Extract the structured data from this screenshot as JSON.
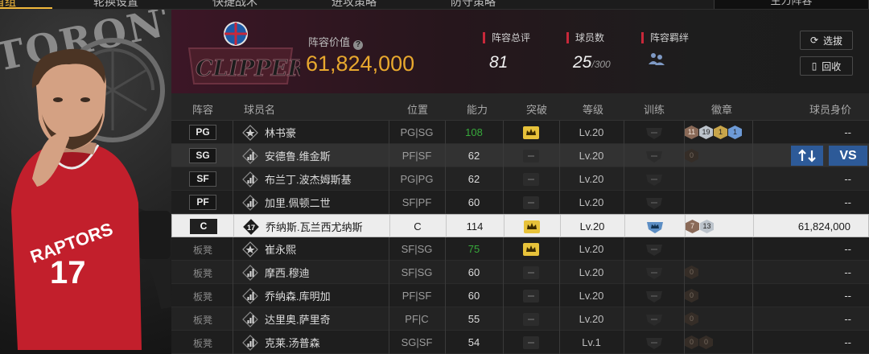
{
  "nav": {
    "tabs": [
      "首组",
      "轮换设置",
      "快捷战术",
      "进攻策略",
      "防守策略"
    ],
    "dropdown": "主力阵容"
  },
  "team": {
    "logo_text": "CLIPPERS",
    "value_label": "阵容价值",
    "value": "61,824,000",
    "overall_label": "阵容总评",
    "overall": "81",
    "players_label": "球员数",
    "players": "25",
    "players_max": "/300",
    "bonds_label": "阵容羁绊",
    "background_text": "TORONTO",
    "player_jersey_team": "RAPTORS",
    "player_jersey_number": "17"
  },
  "buttons": {
    "select": "选拔",
    "recycle": "回收",
    "vs": "VS"
  },
  "table": {
    "headers": [
      "阵容",
      "球员名",
      "位置",
      "能力",
      "突破",
      "等级",
      "训练",
      "徽章",
      "球员身价"
    ],
    "rows": [
      {
        "slot": "PG",
        "bench": false,
        "icon": "star",
        "name": "林书豪",
        "pos": "PG|SG",
        "ability": "108",
        "ability_color": "#37a93b",
        "breakthrough": true,
        "level": "Lv.20",
        "training": false,
        "badges": [
          {
            "v": "11",
            "c": "bronze"
          },
          {
            "v": "19",
            "c": "silver"
          },
          {
            "v": "1",
            "c": "gold"
          },
          {
            "v": "1",
            "c": "blue"
          }
        ],
        "value": "--"
      },
      {
        "slot": "SG",
        "bench": false,
        "icon": "bars",
        "name": "安德鲁.维金斯",
        "pos": "PF|SF",
        "ability": "62",
        "ability_color": "",
        "breakthrough": false,
        "level": "Lv.20",
        "training": false,
        "badges": [
          {
            "v": "0",
            "c": "empty"
          }
        ],
        "value": "",
        "has_actions": true
      },
      {
        "slot": "SF",
        "bench": false,
        "icon": "bars",
        "name": "布兰丁.波杰姆斯基",
        "pos": "PG|PG",
        "ability": "62",
        "ability_color": "",
        "breakthrough": false,
        "level": "Lv.20",
        "training": false,
        "badges": [],
        "value": "--"
      },
      {
        "slot": "PF",
        "bench": false,
        "icon": "bars",
        "name": "加里.佩顿二世",
        "pos": "SF|PF",
        "ability": "60",
        "ability_color": "",
        "breakthrough": false,
        "level": "Lv.20",
        "training": false,
        "badges": [],
        "value": "--"
      },
      {
        "slot": "C",
        "bench": false,
        "icon": "17",
        "name": "乔纳斯.瓦兰西尤纳斯",
        "pos": "C",
        "ability": "114",
        "ability_color": "",
        "breakthrough": true,
        "level": "Lv.20",
        "training": true,
        "badges": [
          {
            "v": "7",
            "c": "bronze"
          },
          {
            "v": "13",
            "c": "silver"
          }
        ],
        "value": "61,824,000",
        "selected": true
      },
      {
        "slot": "板凳",
        "bench": true,
        "icon": "star",
        "name": "崔永熙",
        "pos": "SF|SG",
        "ability": "75",
        "ability_color": "#37a93b",
        "breakthrough": true,
        "level": "Lv.20",
        "training": false,
        "badges": [],
        "value": "--"
      },
      {
        "slot": "板凳",
        "bench": true,
        "icon": "bars",
        "name": "摩西.穆迪",
        "pos": "SF|SG",
        "ability": "60",
        "ability_color": "",
        "breakthrough": false,
        "level": "Lv.20",
        "training": false,
        "badges": [
          {
            "v": "0",
            "c": "empty"
          }
        ],
        "value": "--"
      },
      {
        "slot": "板凳",
        "bench": true,
        "icon": "bars",
        "name": "乔纳森.库明加",
        "pos": "PF|SF",
        "ability": "60",
        "ability_color": "",
        "breakthrough": false,
        "level": "Lv.20",
        "training": false,
        "badges": [
          {
            "v": "0",
            "c": "empty"
          }
        ],
        "value": "--"
      },
      {
        "slot": "板凳",
        "bench": true,
        "icon": "bars",
        "name": "达里奥.萨里奇",
        "pos": "PF|C",
        "ability": "55",
        "ability_color": "",
        "breakthrough": false,
        "level": "Lv.20",
        "training": false,
        "badges": [
          {
            "v": "0",
            "c": "empty"
          }
        ],
        "value": "--"
      },
      {
        "slot": "板凳",
        "bench": true,
        "icon": "bars",
        "name": "克莱.汤普森",
        "pos": "SG|SF",
        "ability": "54",
        "ability_color": "",
        "breakthrough": false,
        "level": "Lv.1",
        "training": false,
        "badges": [
          {
            "v": "0",
            "c": "empty"
          },
          {
            "v": "0",
            "c": "empty"
          }
        ],
        "value": "--"
      }
    ]
  }
}
